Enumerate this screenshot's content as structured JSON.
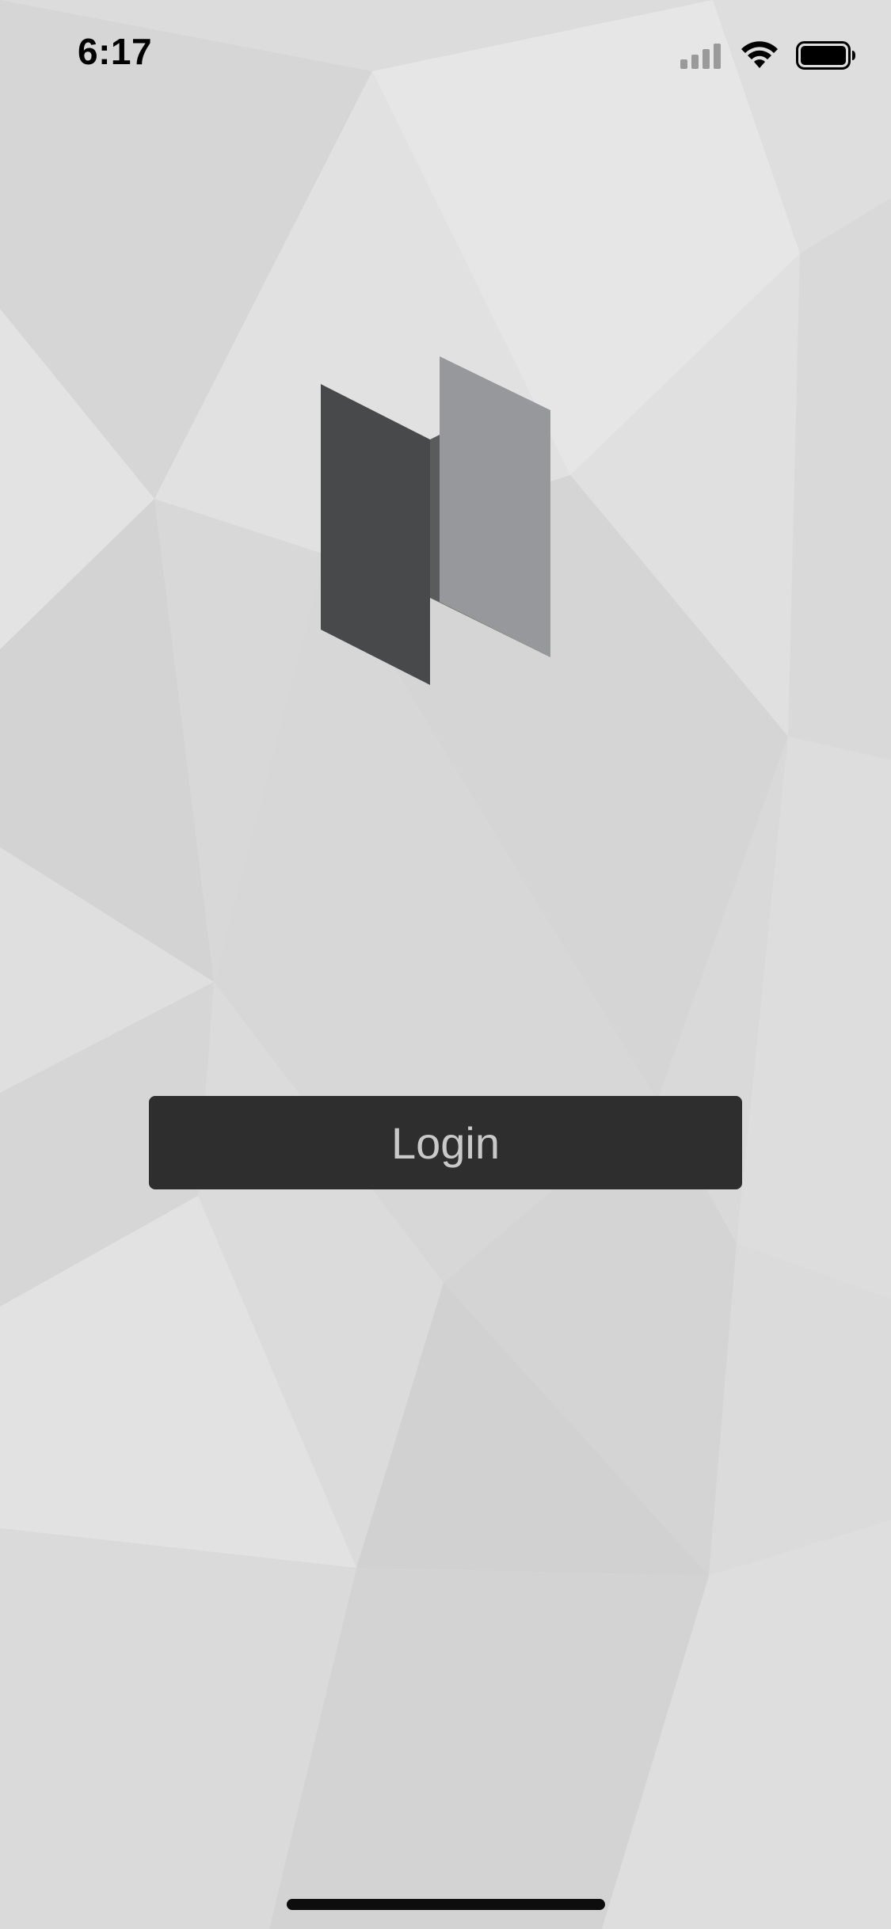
{
  "status_bar": {
    "time": "6:17",
    "icons": [
      "cellular-signal-icon",
      "wifi-icon",
      "battery-icon"
    ]
  },
  "logo": {
    "icon": "app-logo-icon",
    "colors": [
      "#48494b",
      "#6d6e71",
      "#97989b"
    ]
  },
  "login": {
    "label": "Login",
    "background": "#2e2e2e",
    "text_color": "#c9c9c9"
  },
  "background": {
    "style": "low-poly gray triangles"
  }
}
